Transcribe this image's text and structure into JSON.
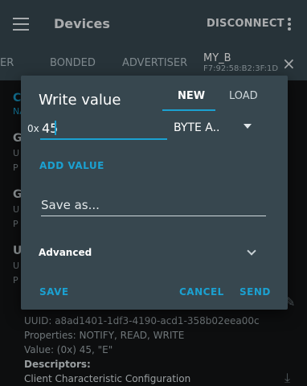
{
  "appbar": {
    "title": "Devices",
    "disconnect_label": "DISCONNECT"
  },
  "tabs": {
    "items": [
      {
        "label": "ER"
      },
      {
        "label": "BONDED"
      },
      {
        "label": "ADVERTISER"
      }
    ],
    "active": {
      "label": "MY_B",
      "address": "F7:92:58:B2:3F:1D"
    },
    "close_icon": "×"
  },
  "background": {
    "rows": [
      {
        "letter": "CO",
        "sub": "NA"
      },
      {
        "letter": "G",
        "sub": "U"
      },
      {
        "letter": "G",
        "sub": "U"
      },
      {
        "letter": "U",
        "sub": "U"
      }
    ],
    "row_p": [
      "P",
      "P",
      "P",
      "P"
    ],
    "uuid_line": "UUID: a8ad1401-1df3-4190-acd1-358b02eea00c",
    "properties_line": "Properties: NOTIFY, READ, WRITE",
    "value_line": "Value: (0x) 45, \"E\"",
    "descriptors_label": "Descriptors:",
    "descriptor_item": "Client Characteristic Configuration"
  },
  "dialog": {
    "title": "Write value",
    "tab_new": "NEW",
    "tab_load": "LOAD",
    "prefix": "0x",
    "value": "45",
    "format": "BYTE A..",
    "add_value_label": "ADD VALUE",
    "save_as_placeholder": "Save as...",
    "advanced_label": "Advanced",
    "save_label": "SAVE",
    "cancel_label": "CANCEL",
    "send_label": "SEND"
  },
  "colors": {
    "accent": "#1ba1d1",
    "appbar": "#37474f",
    "dialog": "#37474f"
  }
}
